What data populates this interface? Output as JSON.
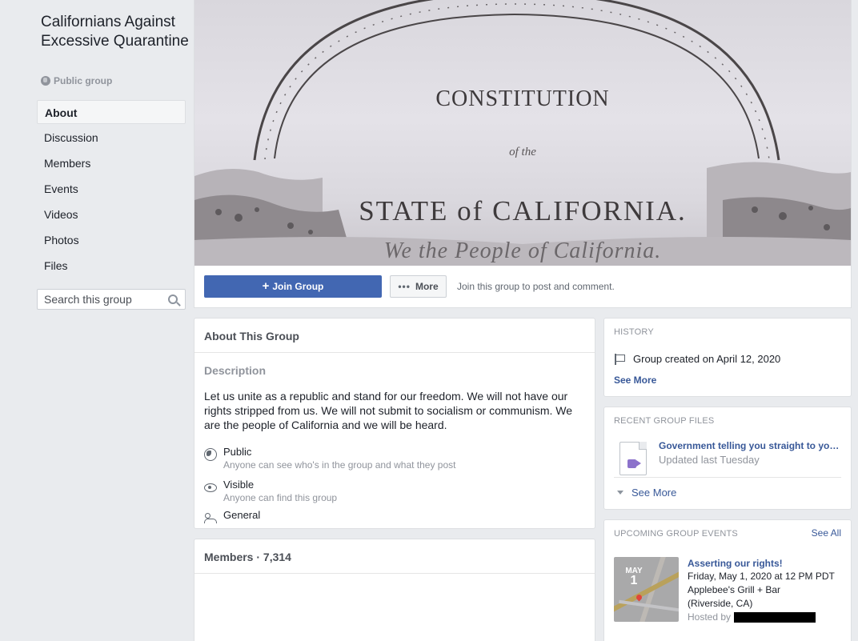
{
  "sidebar": {
    "group_name": "Californians Against Excessive Quarantine",
    "privacy": "Public group",
    "nav": [
      {
        "label": "About",
        "active": true
      },
      {
        "label": "Discussion"
      },
      {
        "label": "Members"
      },
      {
        "label": "Events"
      },
      {
        "label": "Videos"
      },
      {
        "label": "Photos"
      },
      {
        "label": "Files"
      }
    ],
    "search_placeholder": "Search this group"
  },
  "cover": {
    "title": "CONSTITUTION",
    "of_the": "of the",
    "state": "STATE of CALIFORNIA.",
    "people": "We the People of California."
  },
  "actions": {
    "join_label": "Join Group",
    "more_label": "More",
    "hint": "Join this group to post and comment."
  },
  "about": {
    "header": "About This Group",
    "description_label": "Description",
    "description": "Let us unite as a republic and stand for our freedom. We will not have our rights stripped from us. We will not submit to socialism or communism. We are the people of California and we will be heard.",
    "properties": [
      {
        "title": "Public",
        "subtitle": "Anyone can see who's in the group and what they post",
        "icon": "globe-icon"
      },
      {
        "title": "Visible",
        "subtitle": "Anyone can find this group",
        "icon": "eye-icon"
      },
      {
        "title": "General",
        "subtitle": "",
        "icon": "people-icon"
      }
    ]
  },
  "members": {
    "header": "Members · 7,314"
  },
  "history": {
    "label": "HISTORY",
    "created": "Group created on April 12, 2020",
    "see_more": "See More"
  },
  "files": {
    "label": "RECENT GROUP FILES",
    "items": [
      {
        "name": "Government telling you straight to you...",
        "meta": "Updated last Tuesday",
        "icon": "video-file-icon"
      }
    ],
    "see_more": "See More"
  },
  "events": {
    "label": "UPCOMING GROUP EVENTS",
    "see_all": "See All",
    "items": [
      {
        "month": "MAY",
        "day": "1",
        "title": "Asserting our rights!",
        "when": "Friday, May 1, 2020 at 12 PM PDT",
        "venue": "Applebee's Grill + Bar",
        "location": "(Riverside, CA)",
        "hosted_by": "Hosted by"
      }
    ]
  },
  "colors": {
    "accent": "#4267b2",
    "link": "#385898",
    "background": "#e9ebee"
  }
}
